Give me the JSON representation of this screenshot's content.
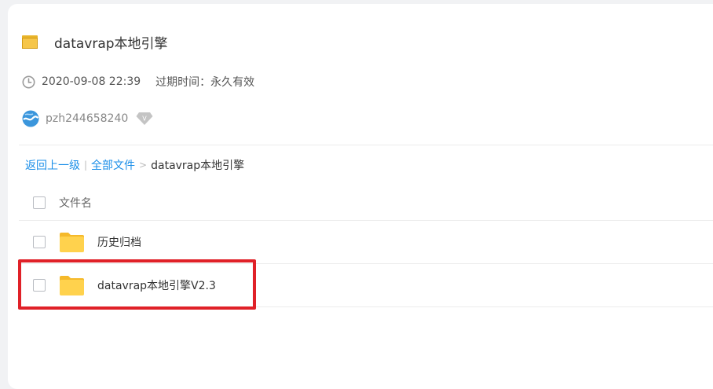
{
  "share": {
    "title": "datavrap本地引擎",
    "date": "2020-09-08 22:39",
    "expire": "过期时间：永久有效",
    "username": "pzh244658240",
    "vip_badge": "V"
  },
  "breadcrumb": {
    "back": "返回上一级",
    "divider": "|",
    "all_files": "全部文件",
    "separator": ">",
    "current": "datavrap本地引擎"
  },
  "file_list": {
    "header": "文件名",
    "items": [
      {
        "name": "历史归档",
        "type": "folder"
      },
      {
        "name": "datavrap本地引擎V2.3",
        "type": "folder"
      }
    ]
  },
  "colors": {
    "link": "#1a8ee8",
    "folder": "#ffd24d",
    "highlight": "#e02128"
  }
}
